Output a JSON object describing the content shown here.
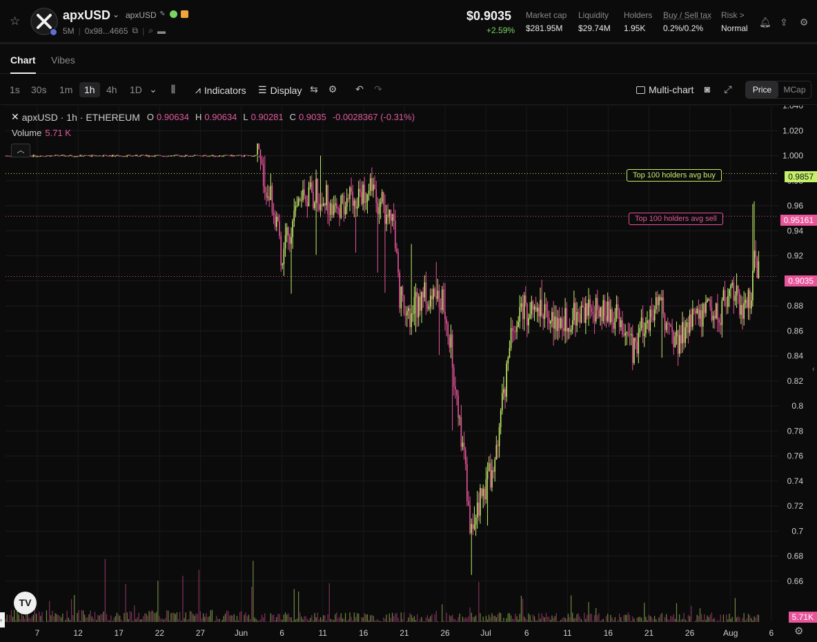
{
  "header": {
    "token_name": "apxUSD",
    "token_symbol": "apxUSD",
    "age": "5M",
    "address": "0x98...4665",
    "price": "$0.9035",
    "change": "+2.59%",
    "stats": [
      {
        "label": "Market cap",
        "value": "$281.95M"
      },
      {
        "label": "Liquidity",
        "value": "$29.74M"
      },
      {
        "label": "Holders",
        "value": "1.95K"
      },
      {
        "label": "Buy / Sell tax",
        "value": "0.2%/0.2%"
      },
      {
        "label": "Risk >",
        "value": "Normal"
      }
    ]
  },
  "tabs": [
    "Chart",
    "Vibes"
  ],
  "toolbar": {
    "timeframes": [
      "1s",
      "30s",
      "1m",
      "1h",
      "4h",
      "1D"
    ],
    "active_timeframe": "1h",
    "indicators": "Indicators",
    "display": "Display",
    "multichart": "Multi-chart",
    "modes": [
      "Price",
      "MCap"
    ],
    "active_mode": "Price"
  },
  "legend": {
    "title": "apxUSD · 1h · ETHEREUM",
    "o_key": "O",
    "o": "0.90634",
    "h_key": "H",
    "h": "0.90634",
    "l_key": "L",
    "l": "0.90281",
    "c_key": "C",
    "c": "0.9035",
    "change": "-0.0028367 (-0.31%)",
    "volume_label": "Volume",
    "volume": "5.71 K"
  },
  "annotations": {
    "avg_buy_label": "Top 100 holders avg buy",
    "avg_buy_value": "0.9857",
    "avg_sell_label": "Top 100 holders avg sell",
    "avg_sell_value": "0.95161",
    "current_price_tag": "0.9035",
    "volume_tag": "5.71K"
  },
  "colors": {
    "up": "#c6f06a",
    "down": "#e8559a",
    "buy_line": "#c6f06a",
    "sell_line": "#e8559a"
  },
  "chart_data": {
    "type": "candlestick",
    "y_ticks": [
      "1.040",
      "1.020",
      "1.000",
      "0.98",
      "0.96",
      "0.94",
      "0.92",
      "0.9",
      "0.88",
      "0.86",
      "0.84",
      "0.82",
      "0.8",
      "0.78",
      "0.76",
      "0.74",
      "0.72",
      "0.7",
      "0.68",
      "0.66"
    ],
    "ylim": [
      0.65,
      1.04
    ],
    "x_ticks": [
      "7",
      "12",
      "17",
      "22",
      "27",
      "Jun",
      "6",
      "11",
      "16",
      "21",
      "26",
      "Jul",
      "6",
      "11",
      "16",
      "21",
      "26",
      "Aug",
      "6"
    ],
    "approx_close_path": [
      [
        0,
        1.0
      ],
      [
        60,
        1.0
      ],
      [
        64,
        0.96
      ],
      [
        66,
        0.92
      ],
      [
        70,
        0.96
      ],
      [
        74,
        0.97
      ],
      [
        80,
        0.96
      ],
      [
        86,
        0.975
      ],
      [
        90,
        0.96
      ],
      [
        93,
        0.94
      ],
      [
        94,
        0.89
      ],
      [
        96,
        0.87
      ],
      [
        100,
        0.89
      ],
      [
        104,
        0.885
      ],
      [
        106,
        0.86
      ],
      [
        108,
        0.8
      ],
      [
        110,
        0.74
      ],
      [
        111,
        0.69
      ],
      [
        113,
        0.72
      ],
      [
        115,
        0.74
      ],
      [
        117,
        0.75
      ],
      [
        119,
        0.81
      ],
      [
        121,
        0.86
      ],
      [
        123,
        0.88
      ],
      [
        125,
        0.875
      ],
      [
        128,
        0.88
      ],
      [
        131,
        0.87
      ],
      [
        134,
        0.87
      ],
      [
        138,
        0.875
      ],
      [
        142,
        0.88
      ],
      [
        146,
        0.87
      ],
      [
        148,
        0.85
      ],
      [
        150,
        0.845
      ],
      [
        152,
        0.86
      ],
      [
        154,
        0.87
      ],
      [
        156,
        0.88
      ],
      [
        158,
        0.87
      ],
      [
        160,
        0.85
      ],
      [
        162,
        0.86
      ],
      [
        164,
        0.87
      ],
      [
        166,
        0.87
      ],
      [
        168,
        0.88
      ],
      [
        170,
        0.87
      ],
      [
        172,
        0.885
      ],
      [
        174,
        0.89
      ],
      [
        176,
        0.88
      ],
      [
        178,
        0.89
      ],
      [
        179,
        0.92
      ],
      [
        180,
        0.9035
      ]
    ],
    "volume_note": "5.71K"
  }
}
